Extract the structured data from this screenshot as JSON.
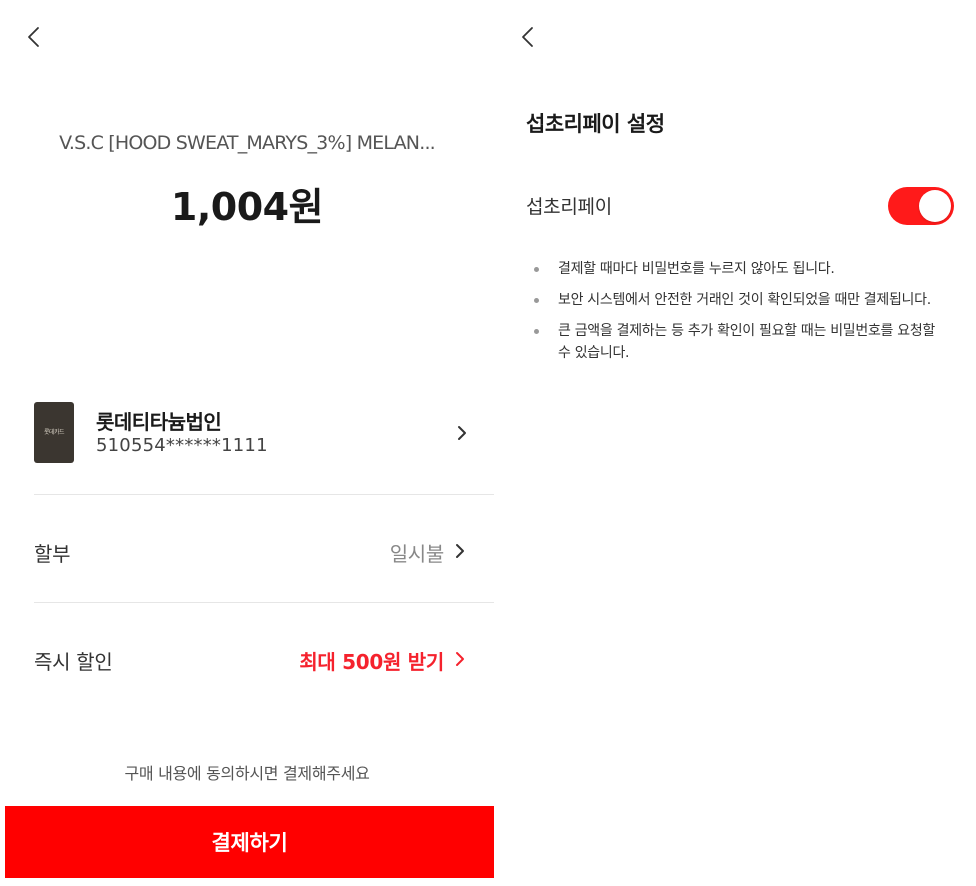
{
  "payment": {
    "product_name": "V.S.C [HOOD SWEAT_MARYS_3%] MELAN...",
    "price": "1,004원",
    "card": {
      "thumb_label": "롯데카드",
      "name": "롯데티타늄법인",
      "number": "510554******1111"
    },
    "installment": {
      "label": "할부",
      "value": "일시불"
    },
    "instant_discount": {
      "label": "즉시 할인",
      "value": "최대 500원 받기"
    },
    "consent_text": "구매 내용에 동의하시면 결제해주세요",
    "pay_button_label": "결제하기"
  },
  "settings": {
    "title": "섭초리페이 설정",
    "toggle_label": "섭초리페이",
    "toggle_on": true,
    "notes": [
      "결제할 때마다 비밀번호를 누르지 않아도 됩니다.",
      "보안 시스템에서 안전한 거래인 것이 확인되었을 때만 결제됩니다.",
      "큰 금액을 결제하는 등 추가 확인이 필요할 때는 비밀번호를 요청할 수 있습니다."
    ]
  },
  "icons": {
    "back": "chevron-left-icon",
    "row_chevron": "chevron-right-icon"
  },
  "colors": {
    "accent_red": "#ff0000",
    "toggle_on": "#ff1a1a",
    "discount_text": "#f5222d",
    "card_thumb": "#3b3630"
  }
}
